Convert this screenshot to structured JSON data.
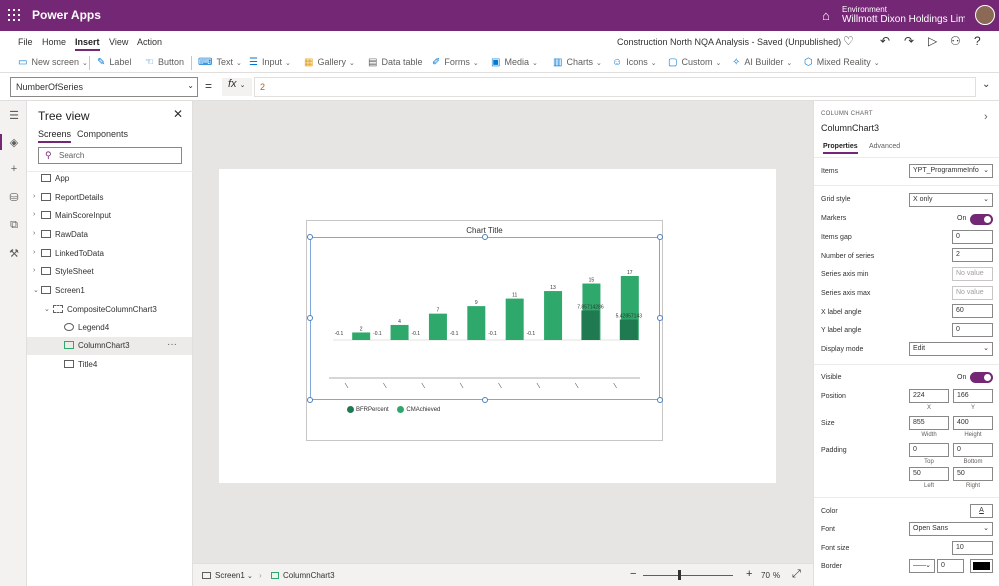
{
  "app": {
    "name": "Power Apps"
  },
  "environment": {
    "label": "Environment",
    "name": "Willmott Dixon Holdings Limite..."
  },
  "menu": {
    "file": "File",
    "home": "Home",
    "insert": "Insert",
    "view": "View",
    "action": "Action"
  },
  "save_status": "Construction North NQA Analysis - Saved (Unpublished)",
  "ribbon": {
    "new_screen": "New screen",
    "label": "Label",
    "button": "Button",
    "text": "Text",
    "input": "Input",
    "gallery": "Gallery",
    "data_table": "Data table",
    "forms": "Forms",
    "media": "Media",
    "charts": "Charts",
    "icons": "Icons",
    "custom": "Custom",
    "ai_builder": "AI Builder",
    "mixed_reality": "Mixed Reality"
  },
  "formula": {
    "property": "NumberOfSeries",
    "equals": "=",
    "fx": "fx",
    "value": "2"
  },
  "tree": {
    "title": "Tree view",
    "tabs": {
      "screens": "Screens",
      "components": "Components"
    },
    "search_placeholder": "Search",
    "items": [
      {
        "label": "App"
      },
      {
        "label": "ReportDetails"
      },
      {
        "label": "MainScoreInput"
      },
      {
        "label": "RawData"
      },
      {
        "label": "LinkedToData"
      },
      {
        "label": "StyleSheet"
      },
      {
        "label": "Screen1"
      },
      {
        "label": "CompositeColumnChart3"
      },
      {
        "label": "Legend4"
      },
      {
        "label": "ColumnChart3"
      },
      {
        "label": "Title4"
      }
    ],
    "more": "···"
  },
  "chart_data": {
    "type": "bar",
    "title": "Chart Title",
    "categories": [
      "",
      "",
      "",
      "",
      "",
      "",
      "",
      ""
    ],
    "series": [
      {
        "name": "BFRPercent",
        "color": "#1f7a52",
        "values": [
          -0.1,
          -0.1,
          -0.1,
          -0.1,
          -0.1,
          -0.1,
          7.857142857,
          5.428571429
        ],
        "labels": [
          "-0.1",
          "-0.1",
          "-0.1",
          "-0.1",
          "-0.1",
          "-0.1",
          "7.85714286",
          "5.42857143"
        ]
      },
      {
        "name": "CMAchieved",
        "color": "#2ea96b",
        "values": [
          2,
          4,
          7,
          9,
          11,
          13,
          15,
          17
        ],
        "labels": [
          "2",
          "4",
          "7",
          "9",
          "11",
          "13",
          "15",
          "17"
        ]
      }
    ],
    "ylim": [
      -0.1,
      17
    ],
    "x_label_angle": 60,
    "grid": "x only"
  },
  "status": {
    "screen": "Screen1",
    "control": "ColumnChart3",
    "zoom_minus": "−",
    "zoom_plus": "+",
    "zoom_value": "70",
    "zoom_unit": "%",
    "zoom_level": 0.7
  },
  "props": {
    "type": "COLUMN CHART",
    "name": "ColumnChart3",
    "tabs": {
      "properties": "Properties",
      "advanced": "Advanced"
    },
    "items_label": "Items",
    "items_value": "YPT_ProgrammeInfo",
    "grid_label": "Grid style",
    "grid_value": "X only",
    "markers_label": "Markers",
    "markers_state": "On",
    "gap_label": "Items gap",
    "gap_value": "0",
    "series_label": "Number of series",
    "series_value": "2",
    "axis_min_label": "Series axis min",
    "axis_min_placeholder": "No value",
    "axis_max_label": "Series axis max",
    "axis_max_placeholder": "No value",
    "xangle_label": "X label angle",
    "xangle_value": "60",
    "yangle_label": "Y label angle",
    "yangle_value": "0",
    "display_label": "Display mode",
    "display_value": "Edit",
    "visible_label": "Visible",
    "visible_state": "On",
    "position_label": "Position",
    "pos_x": "224",
    "pos_y": "166",
    "pos_x_lbl": "X",
    "pos_y_lbl": "Y",
    "size_label": "Size",
    "width": "855",
    "height": "400",
    "width_lbl": "Width",
    "height_lbl": "Height",
    "padding_label": "Padding",
    "pad_top": "0",
    "pad_bottom": "0",
    "pad_left": "50",
    "pad_right": "50",
    "pad_top_lbl": "Top",
    "pad_bottom_lbl": "Bottom",
    "pad_left_lbl": "Left",
    "pad_right_lbl": "Right",
    "color_label": "Color",
    "color_glyph": "A",
    "font_label": "Font",
    "font_value": "Open Sans",
    "fontsize_label": "Font size",
    "fontsize_value": "10",
    "border_label": "Border",
    "border_width": "0",
    "border_color": "#000000"
  },
  "colors": {
    "brand": "#742774",
    "accent": "#0078d4"
  }
}
